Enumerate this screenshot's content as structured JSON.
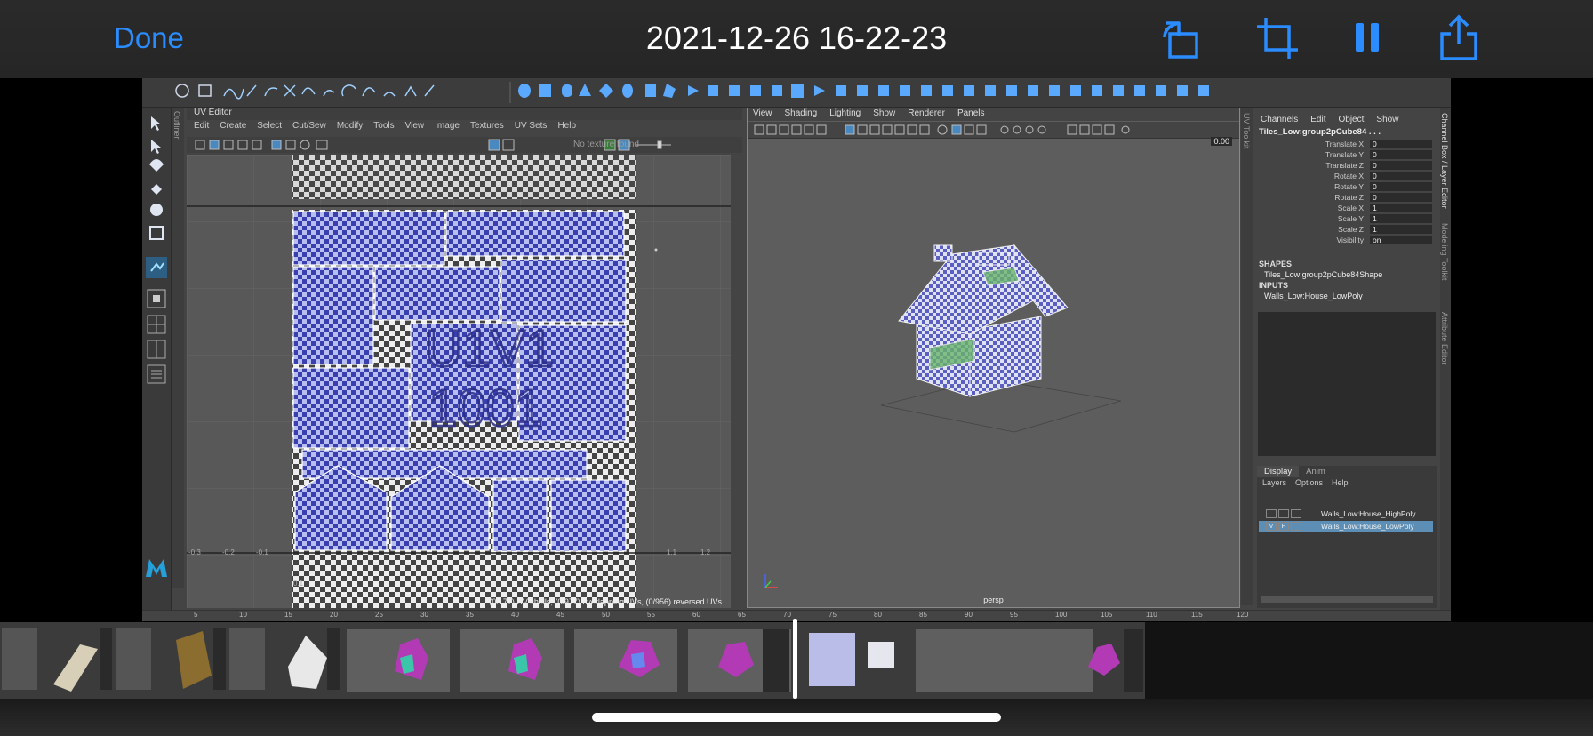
{
  "topbar": {
    "done_label": "Done",
    "title": "2021-12-26 16-22-23",
    "icons": [
      "rotate-icon",
      "crop-icon",
      "pause-icon",
      "share-icon"
    ],
    "accent_color": "#2a8cff"
  },
  "maya": {
    "uv_editor": {
      "panel_title": "UV Editor",
      "menus": [
        "Edit",
        "Create",
        "Select",
        "Cut/Sew",
        "Modify",
        "Tools",
        "View",
        "Image",
        "Textures",
        "UV Sets",
        "Help"
      ],
      "texture_status": "No texture found",
      "tile_text_top": "U1V1",
      "tile_text_bottom": "1001",
      "status": "(0/177) UV shells, (0/977) overlapping UVs, (0/956) reversed UVs",
      "ticks_bottom": [
        "-0.3",
        "-0.2",
        "-0.1",
        "1.1",
        "1.2"
      ],
      "tick_left": "0.1"
    },
    "side_tabs": {
      "outliner": "Outliner",
      "uv_toolkit": "UV Toolkit",
      "channel_box": "Channel Box / Layer Editor",
      "modeling_toolkit": "Modeling Toolkit",
      "attribute_editor": "Attribute Editor"
    },
    "viewport": {
      "menus": [
        "View",
        "Shading",
        "Lighting",
        "Show",
        "Renderer",
        "Panels"
      ],
      "camera_field": "0.00",
      "camera_label": "persp"
    },
    "channel_box": {
      "menus": [
        "Channels",
        "Edit",
        "Object",
        "Show"
      ],
      "object_name": "Tiles_Low:group2pCube84 . . .",
      "attributes": [
        {
          "label": "Translate X",
          "value": "0"
        },
        {
          "label": "Translate Y",
          "value": "0"
        },
        {
          "label": "Translate Z",
          "value": "0"
        },
        {
          "label": "Rotate X",
          "value": "0"
        },
        {
          "label": "Rotate Y",
          "value": "0"
        },
        {
          "label": "Rotate Z",
          "value": "0"
        },
        {
          "label": "Scale X",
          "value": "1"
        },
        {
          "label": "Scale Y",
          "value": "1"
        },
        {
          "label": "Scale Z",
          "value": "1"
        },
        {
          "label": "Visibility",
          "value": "on"
        }
      ],
      "shapes_header": "SHAPES",
      "shape_item": "Tiles_Low:group2pCube84Shape",
      "inputs_header": "INPUTS",
      "input_item": "Walls_Low:House_LowPoly"
    },
    "layer_editor": {
      "tabs": [
        "Display",
        "Anim"
      ],
      "menus": [
        "Layers",
        "Options",
        "Help"
      ],
      "layers": [
        {
          "name": "Walls_Low:House_HighPoly",
          "v": "",
          "p": "",
          "selected": false
        },
        {
          "name": "Walls_Low:House_LowPoly",
          "v": "V",
          "p": "P",
          "selected": true
        }
      ]
    },
    "timeline_ticks": [
      "5",
      "10",
      "15",
      "20",
      "25",
      "30",
      "35",
      "40",
      "45",
      "50",
      "55",
      "60",
      "65",
      "70",
      "75",
      "80",
      "85",
      "90",
      "95",
      "100",
      "105",
      "110",
      "115",
      "120"
    ]
  },
  "filmstrip": {
    "selection_color": "#ffffff"
  }
}
